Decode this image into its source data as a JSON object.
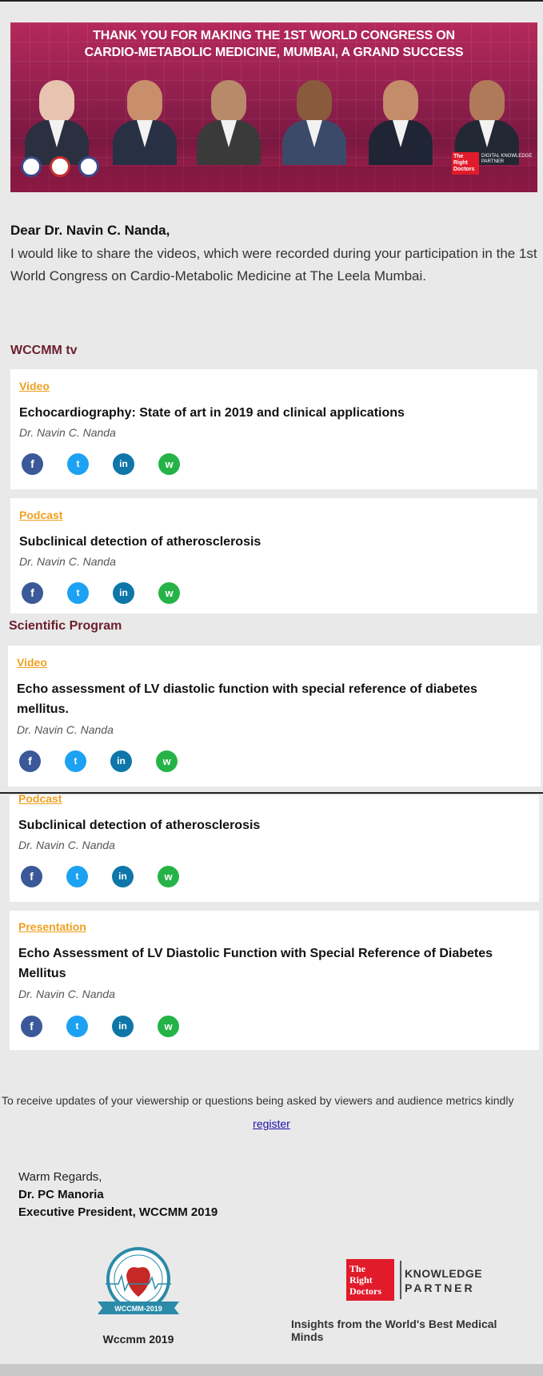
{
  "banner": {
    "line1": "THANK YOU FOR MAKING THE 1ST WORLD CONGRESS ON",
    "line2": "CARDIO-METABOLIC MEDICINE, MUMBAI, A GRAND SUCCESS",
    "logo_text": "The Right Doctors",
    "logo_caption": "DIGITAL KNOWLEDGE PARTNER"
  },
  "greeting": "Dear Dr. Navin C. Nanda,",
  "intro": "I would like to share the videos, which were recorded during your participation in the 1st World Congress on Cardio-Metabolic Medicine at The Leela Mumbai.",
  "sections": [
    {
      "title": "WCCMM tv",
      "items": [
        {
          "type": "Video",
          "title": "Echocardiography: State of art in 2019 and clinical applications",
          "author": "Dr. Navin C. Nanda"
        },
        {
          "type": "Podcast",
          "title": "Subclinical detection of atherosclerosis",
          "author": "Dr. Navin C. Nanda"
        }
      ]
    },
    {
      "title": "Scientific Program",
      "items": [
        {
          "type": "Video",
          "title": "Echo assessment of LV diastolic function with special reference of diabetes mellitus.",
          "author": "Dr. Navin C. Nanda"
        },
        {
          "type": "Podcast",
          "title": "Subclinical detection of atherosclerosis",
          "author": "Dr. Navin C. Nanda"
        },
        {
          "type": "Presentation",
          "title": "Echo Assessment of LV Diastolic Function with Special Reference of Diabetes Mellitus",
          "author": "Dr. Navin C. Nanda"
        }
      ]
    }
  ],
  "social": {
    "fb": "f",
    "tw": "t",
    "li": "in",
    "wa": "w"
  },
  "footer": {
    "note": "To receive updates of your viewership or questions being asked by viewers and audience metrics kindly",
    "register": "register",
    "regards": "Warm Regards,",
    "signer": "Dr. PC Manoria",
    "role": "Executive President, WCCMM 2019",
    "wccmm_label": "Wccmm 2019",
    "wccmm_badge": "WCCMM-2019",
    "trd_line1": "The",
    "trd_line2": "Right",
    "trd_line3": "Doctors",
    "partner1": "KNOWLEDGE",
    "partner2": "PARTNER",
    "tagline": "Insights from the World's Best Medical Minds"
  },
  "colors": {
    "accent": "#6b1f2e",
    "type_label": "#f0a020",
    "link": "#1a0dab"
  }
}
